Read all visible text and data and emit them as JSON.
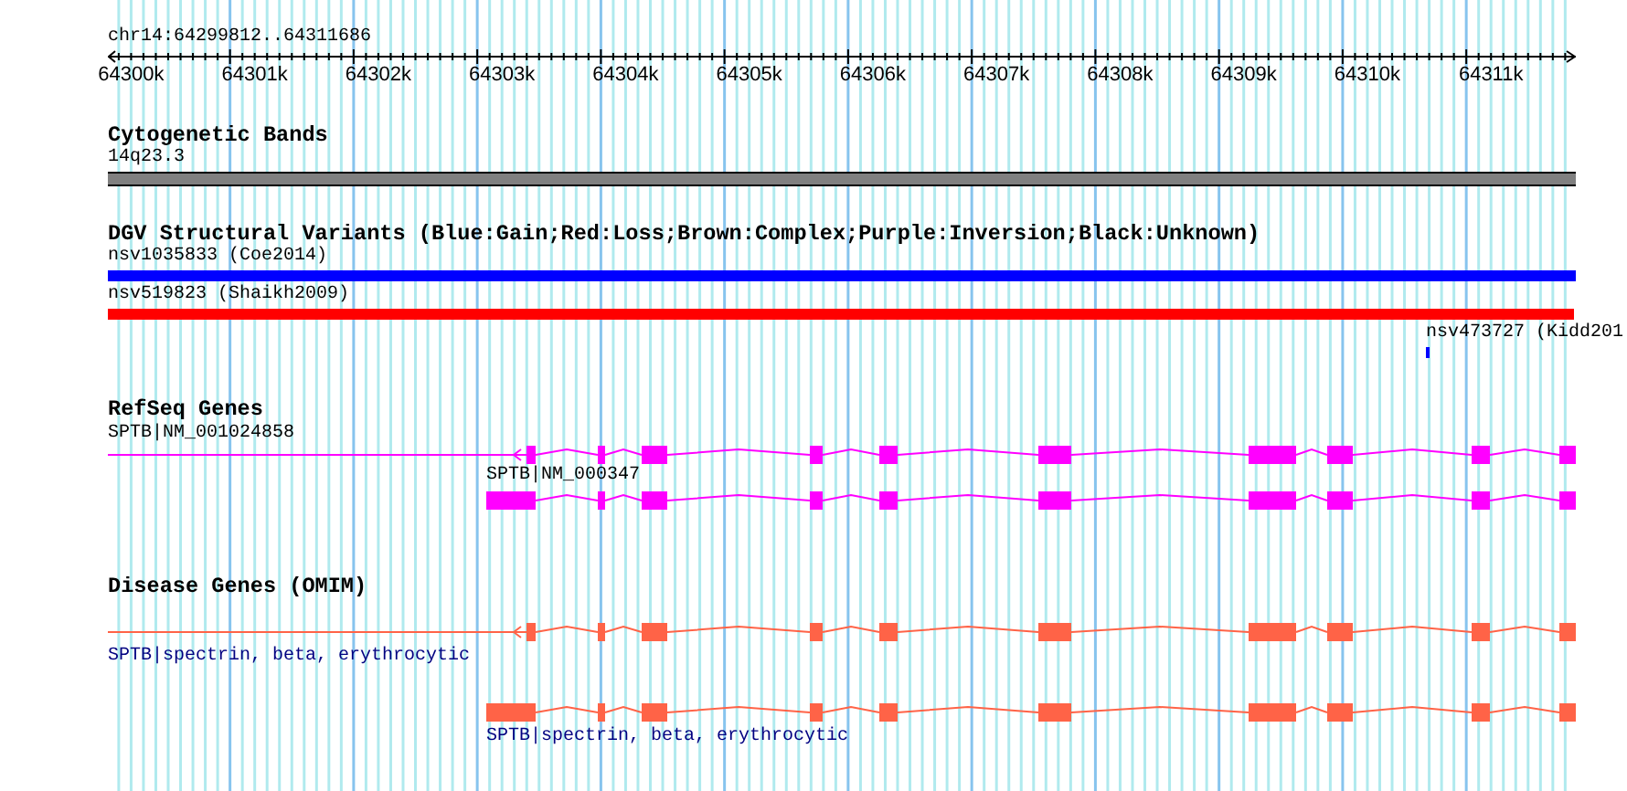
{
  "ruler": {
    "range": "chr14:64299812..64311686",
    "ticks": [
      "64300k",
      "64301k",
      "64302k",
      "64303k",
      "64304k",
      "64305k",
      "64306k",
      "64307k",
      "64308k",
      "64309k",
      "64310k",
      "64311k"
    ]
  },
  "tracks": [
    {
      "kind": "band",
      "title": "Cytogenetic Bands",
      "features": [
        {
          "label": "14q23.3"
        }
      ]
    },
    {
      "kind": "variant",
      "title": "DGV Structural Variants (Blue:Gain;Red:Loss;Brown:Complex;Purple:Inversion;Black:Unknown)",
      "features": [
        {
          "label": "nsv1035833 (Coe2014)",
          "color": "#0000ff"
        },
        {
          "label": "nsv519823 (Shaikh2009)",
          "color": "#ff0000"
        },
        {
          "label": "nsv473727 (Kidd201",
          "color": "#0000ff"
        }
      ]
    },
    {
      "kind": "gene",
      "title": "RefSeq Genes",
      "features": [
        {
          "label": "SPTB|NM_001024858"
        },
        {
          "label": "SPTB|NM_000347"
        }
      ]
    },
    {
      "kind": "disease",
      "title": "Disease Genes (OMIM)",
      "features": [
        {
          "label": "SPTB|spectrin, beta, erythrocytic"
        },
        {
          "label": "SPTB|spectrin, beta, erythrocytic"
        }
      ]
    }
  ]
}
